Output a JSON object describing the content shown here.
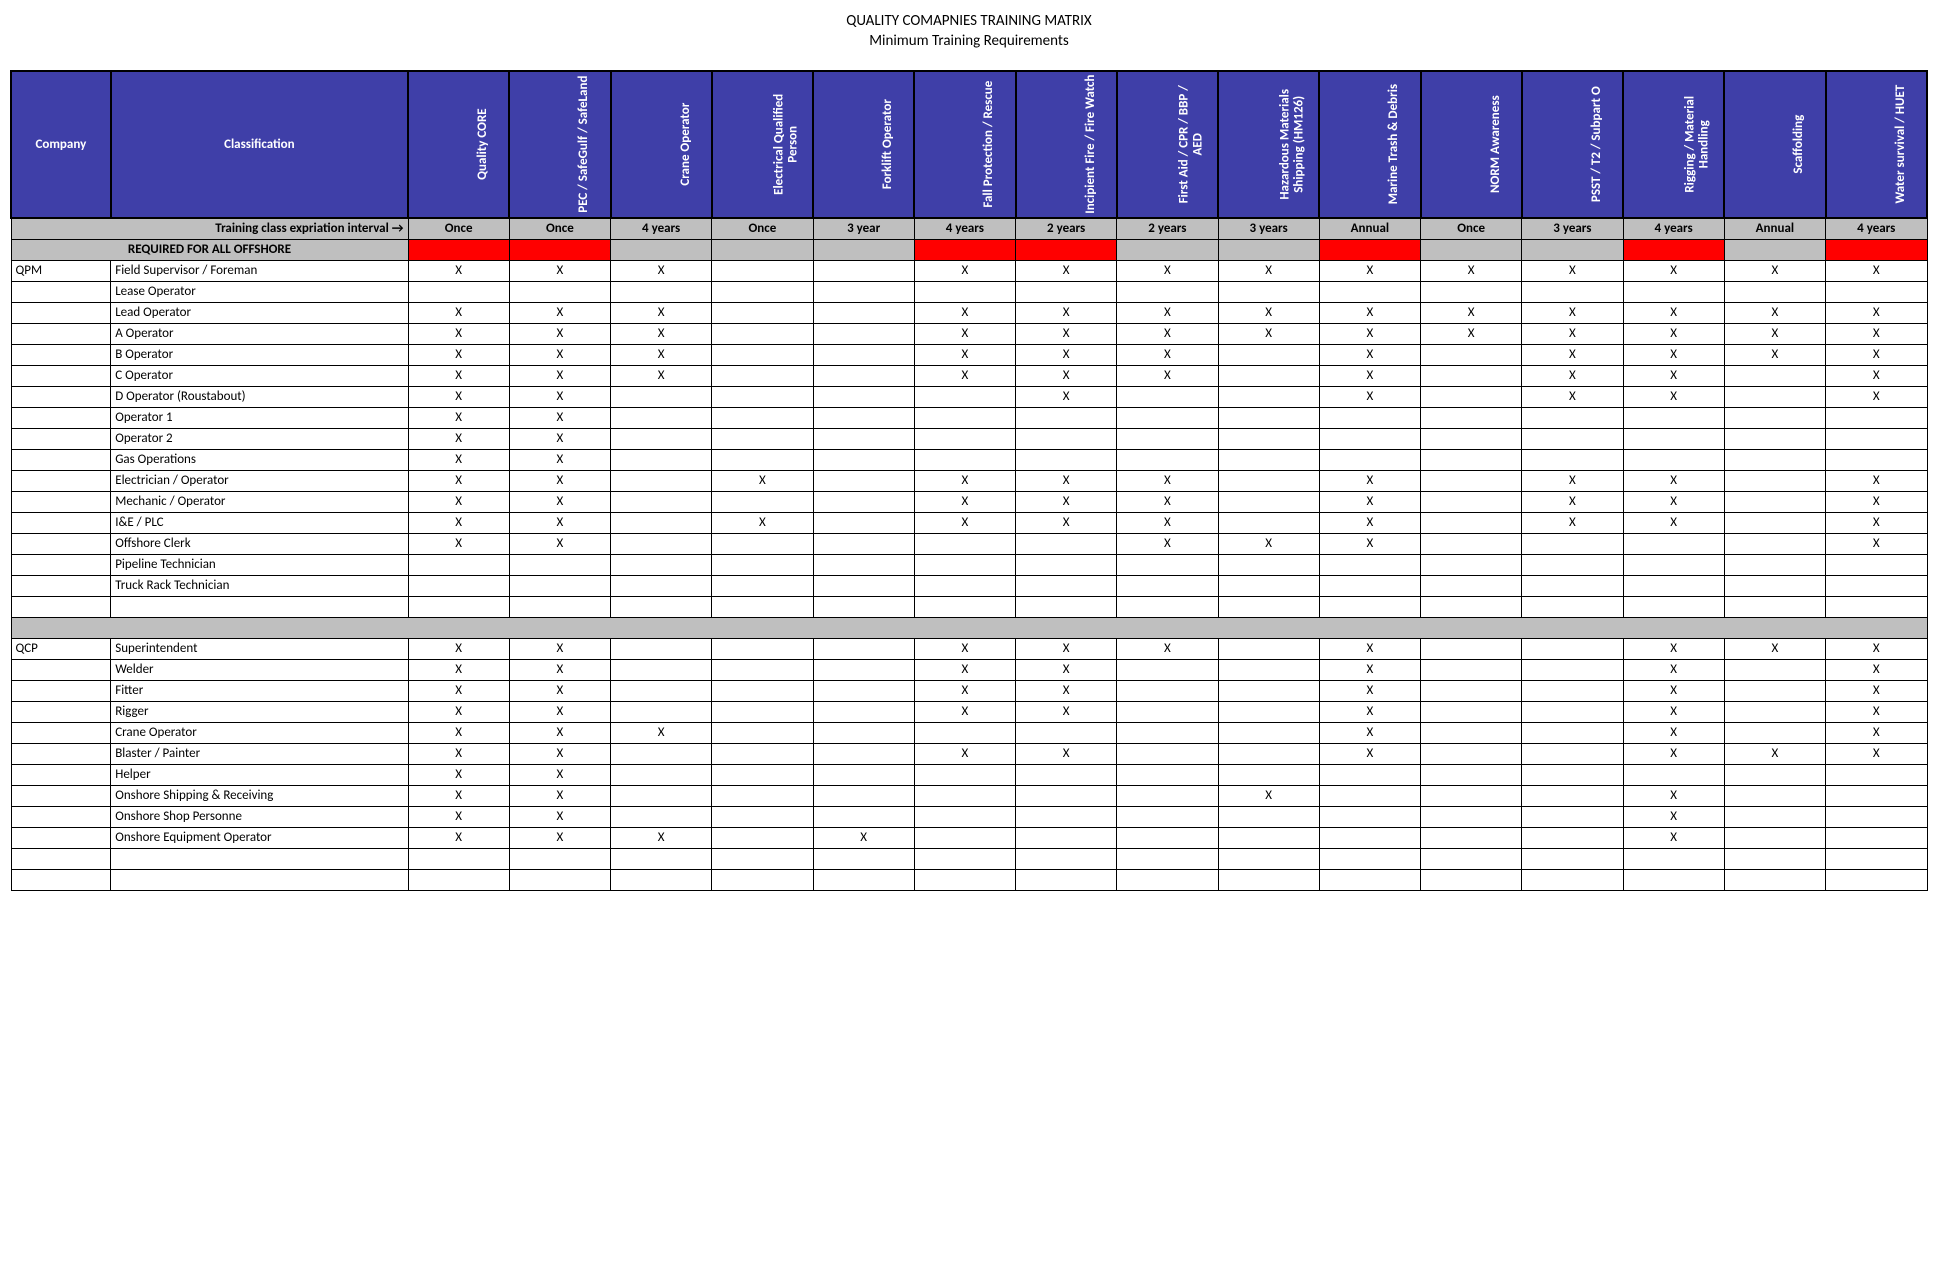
{
  "title1": "QUALITY COMAPNIES TRAINING MATRIX",
  "title2": "Minimum Training Requirements",
  "headers": {
    "company": "Company",
    "classification": "Classification",
    "trainings": [
      "Quality CORE",
      "PEC / SafeGulf / SafeLand",
      "Crane Operator",
      "Electrical Qualified Person",
      "Forklift Operator",
      "Fall Protection / Rescue",
      "Incipient Fire / Fire Watch",
      "First Aid / CPR / BBP / AED",
      "Hazardous Materials Shipping (HM126)",
      "Marine Trash & Debris",
      "NORM Awareness",
      "PSST / T2 / Subpart O",
      "Rigging / Material Handling",
      "Scaffolding",
      "Water survival / HUET"
    ]
  },
  "interval_label": "Training class expriation interval   →",
  "intervals": [
    "Once",
    "Once",
    "4 years",
    "Once",
    "3 year",
    "4 years",
    "2 years",
    "2 years",
    "3 years",
    "Annual",
    "Once",
    "3 years",
    "4 years",
    "Annual",
    "4 years"
  ],
  "required_label": "REQUIRED FOR ALL OFFSHORE",
  "required_red": [
    true,
    true,
    false,
    false,
    false,
    true,
    true,
    false,
    false,
    true,
    false,
    false,
    true,
    false,
    true
  ],
  "rows": [
    {
      "type": "data",
      "company": "QPM",
      "classification": "Field Supervisor / Foreman",
      "marks": [
        "X",
        "X",
        "X",
        "",
        "",
        "X",
        "X",
        "X",
        "X",
        "X",
        "X",
        "X",
        "X",
        "X",
        "X"
      ]
    },
    {
      "type": "data",
      "company": "",
      "classification": "Lease Operator",
      "marks": [
        "",
        "",
        "",
        "",
        "",
        "",
        "",
        "",
        "",
        "",
        "",
        "",
        "",
        "",
        ""
      ]
    },
    {
      "type": "data",
      "company": "",
      "classification": "Lead Operator",
      "marks": [
        "X",
        "X",
        "X",
        "",
        "",
        "X",
        "X",
        "X",
        "X",
        "X",
        "X",
        "X",
        "X",
        "X",
        "X"
      ]
    },
    {
      "type": "data",
      "company": "",
      "classification": "A Operator",
      "marks": [
        "X",
        "X",
        "X",
        "",
        "",
        "X",
        "X",
        "X",
        "X",
        "X",
        "X",
        "X",
        "X",
        "X",
        "X"
      ]
    },
    {
      "type": "data",
      "company": "",
      "classification": "B Operator",
      "marks": [
        "X",
        "X",
        "X",
        "",
        "",
        "X",
        "X",
        "X",
        "",
        "X",
        "",
        "X",
        "X",
        "X",
        "X"
      ]
    },
    {
      "type": "data",
      "company": "",
      "classification": "C Operator",
      "marks": [
        "X",
        "X",
        "X",
        "",
        "",
        "X",
        "X",
        "X",
        "",
        "X",
        "",
        "X",
        "X",
        "",
        "X"
      ]
    },
    {
      "type": "data",
      "company": "",
      "classification": "D Operator (Roustabout)",
      "marks": [
        "X",
        "X",
        "",
        "",
        "",
        "",
        "X",
        "",
        "",
        "X",
        "",
        "X",
        "X",
        "",
        "X"
      ]
    },
    {
      "type": "data",
      "company": "",
      "classification": "Operator 1",
      "marks": [
        "X",
        "X",
        "",
        "",
        "",
        "",
        "",
        "",
        "",
        "",
        "",
        "",
        "",
        "",
        ""
      ]
    },
    {
      "type": "data",
      "company": "",
      "classification": "Operator 2",
      "marks": [
        "X",
        "X",
        "",
        "",
        "",
        "",
        "",
        "",
        "",
        "",
        "",
        "",
        "",
        "",
        ""
      ]
    },
    {
      "type": "data",
      "company": "",
      "classification": "Gas Operations",
      "marks": [
        "X",
        "X",
        "",
        "",
        "",
        "",
        "",
        "",
        "",
        "",
        "",
        "",
        "",
        "",
        ""
      ]
    },
    {
      "type": "data",
      "company": "",
      "classification": "Electrician / Operator",
      "marks": [
        "X",
        "X",
        "",
        "X",
        "",
        "X",
        "X",
        "X",
        "",
        "X",
        "",
        "X",
        "X",
        "",
        "X"
      ]
    },
    {
      "type": "data",
      "company": "",
      "classification": "Mechanic / Operator",
      "marks": [
        "X",
        "X",
        "",
        "",
        "",
        "X",
        "X",
        "X",
        "",
        "X",
        "",
        "X",
        "X",
        "",
        "X"
      ]
    },
    {
      "type": "data",
      "company": "",
      "classification": "I&E / PLC",
      "marks": [
        "X",
        "X",
        "",
        "X",
        "",
        "X",
        "X",
        "X",
        "",
        "X",
        "",
        "X",
        "X",
        "",
        "X"
      ]
    },
    {
      "type": "data",
      "company": "",
      "classification": "Offshore Clerk",
      "marks": [
        "X",
        "X",
        "",
        "",
        "",
        "",
        "",
        "X",
        "X",
        "X",
        "",
        "",
        "",
        "",
        "X"
      ]
    },
    {
      "type": "data",
      "company": "",
      "classification": "Pipeline Technician",
      "marks": [
        "",
        "",
        "",
        "",
        "",
        "",
        "",
        "",
        "",
        "",
        "",
        "",
        "",
        "",
        ""
      ]
    },
    {
      "type": "data",
      "company": "",
      "classification": "Truck Rack Technician",
      "marks": [
        "",
        "",
        "",
        "",
        "",
        "",
        "",
        "",
        "",
        "",
        "",
        "",
        "",
        "",
        ""
      ]
    },
    {
      "type": "blank"
    },
    {
      "type": "spacer"
    },
    {
      "type": "data",
      "company": "QCP",
      "classification": "Superintendent",
      "marks": [
        "X",
        "X",
        "",
        "",
        "",
        "X",
        "X",
        "X",
        "",
        "X",
        "",
        "",
        "X",
        "X",
        "X"
      ]
    },
    {
      "type": "data",
      "company": "",
      "classification": "Welder",
      "marks": [
        "X",
        "X",
        "",
        "",
        "",
        "X",
        "X",
        "",
        "",
        "X",
        "",
        "",
        "X",
        "",
        "X"
      ]
    },
    {
      "type": "data",
      "company": "",
      "classification": "Fitter",
      "marks": [
        "X",
        "X",
        "",
        "",
        "",
        "X",
        "X",
        "",
        "",
        "X",
        "",
        "",
        "X",
        "",
        "X"
      ]
    },
    {
      "type": "data",
      "company": "",
      "classification": "Rigger",
      "marks": [
        "X",
        "X",
        "",
        "",
        "",
        "X",
        "X",
        "",
        "",
        "X",
        "",
        "",
        "X",
        "",
        "X"
      ]
    },
    {
      "type": "data",
      "company": "",
      "classification": "Crane Operator",
      "marks": [
        "X",
        "X",
        "X",
        "",
        "",
        "",
        "",
        "",
        "",
        "X",
        "",
        "",
        "X",
        "",
        "X"
      ]
    },
    {
      "type": "data",
      "company": "",
      "classification": "Blaster / Painter",
      "marks": [
        "X",
        "X",
        "",
        "",
        "",
        "X",
        "X",
        "",
        "",
        "X",
        "",
        "",
        "X",
        "X",
        "X"
      ]
    },
    {
      "type": "data",
      "company": "",
      "classification": "Helper",
      "marks": [
        "X",
        "X",
        "",
        "",
        "",
        "",
        "",
        "",
        "",
        "",
        "",
        "",
        "",
        "",
        ""
      ]
    },
    {
      "type": "data",
      "company": "",
      "classification": "Onshore Shipping & Receiving",
      "marks": [
        "X",
        "X",
        "",
        "",
        "",
        "",
        "",
        "",
        "X",
        "",
        "",
        "",
        "X",
        "",
        ""
      ]
    },
    {
      "type": "data",
      "company": "",
      "classification": "Onshore Shop Personne",
      "marks": [
        "X",
        "X",
        "",
        "",
        "",
        "",
        "",
        "",
        "",
        "",
        "",
        "",
        "X",
        "",
        ""
      ]
    },
    {
      "type": "data",
      "company": "",
      "classification": "Onshore Equipment Operator",
      "marks": [
        "X",
        "X",
        "X",
        "",
        "X",
        "",
        "",
        "",
        "",
        "",
        "",
        "",
        "X",
        "",
        ""
      ]
    },
    {
      "type": "blank"
    },
    {
      "type": "blank"
    }
  ]
}
